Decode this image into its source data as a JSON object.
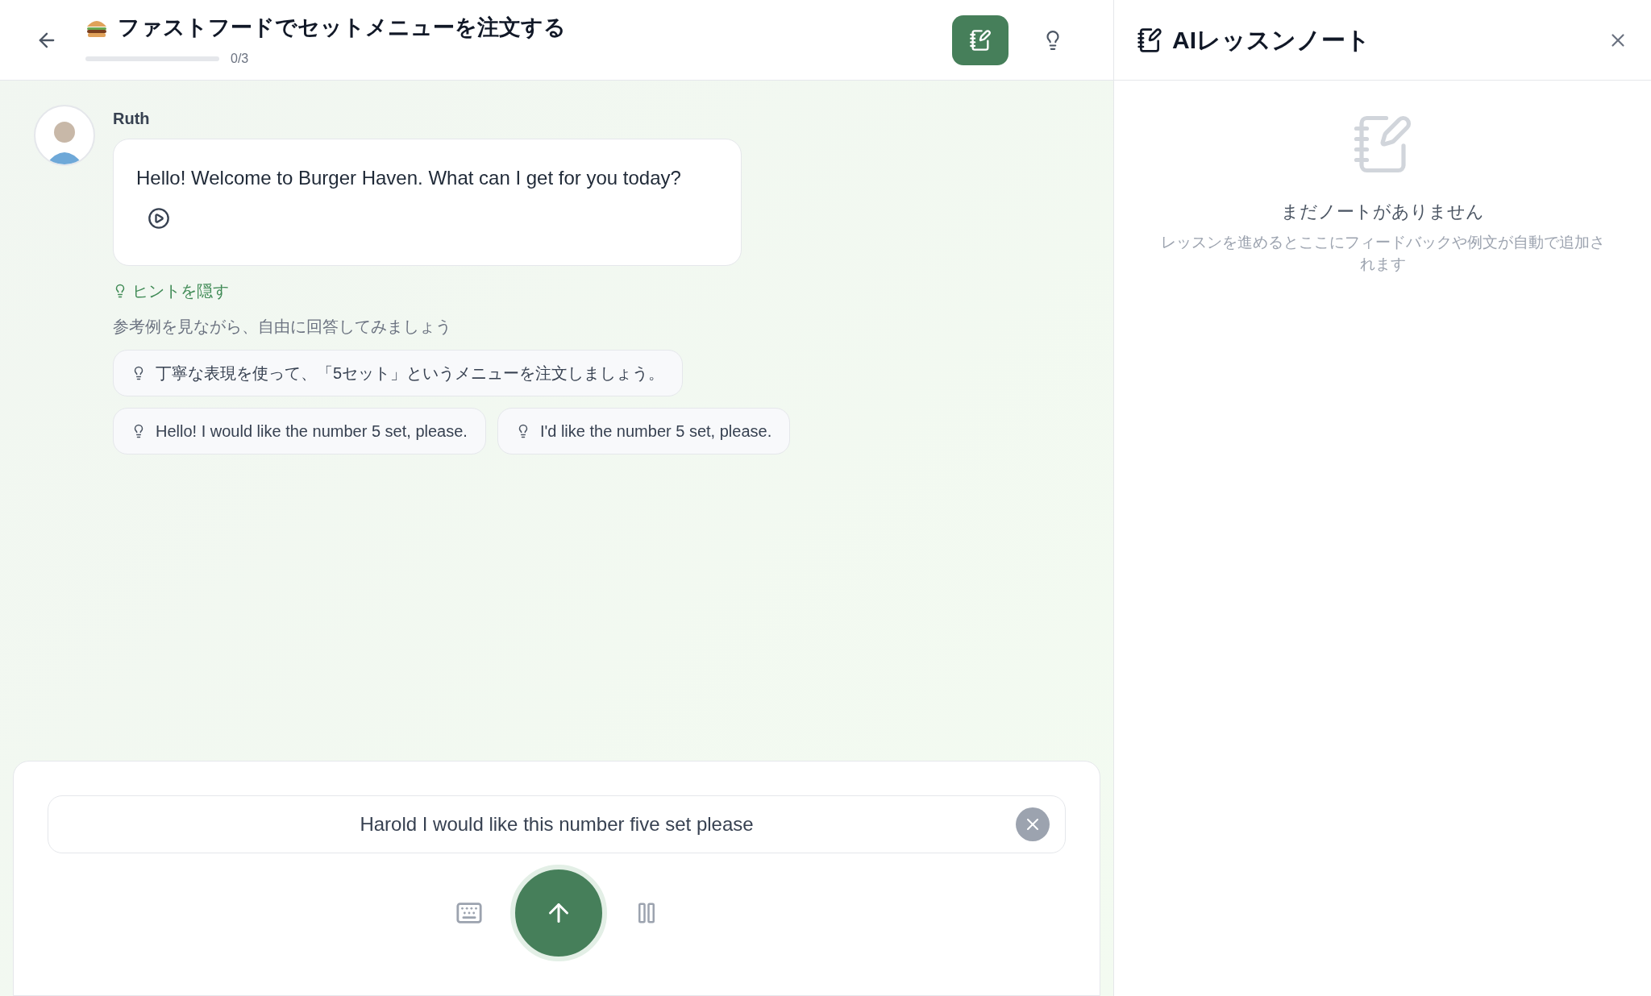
{
  "header": {
    "title": "ファストフードでセットメニューを注文する",
    "progress": {
      "level": 0,
      "reading": "0/3"
    },
    "notes_button": {
      "selected": true
    }
  },
  "message": {
    "speaker": "Ruth",
    "text": "Hello! Welcome to Burger Haven. What can I get for you today?"
  },
  "hints": {
    "toggle": "ヒントを隠す",
    "expanded": true,
    "instruction": "参考例を見ながら、自由に回答してみましょう",
    "items": [
      {
        "text": "丁寧な表現を使って、「5セット」というメニューを注文しましょう。"
      },
      {
        "text": "Hello! I would like the number 5 set, please."
      },
      {
        "text": "I'd like the number 5 set, please."
      }
    ]
  },
  "input": {
    "value": "Harold I would like this number five set please"
  },
  "notes_panel": {
    "title": "AIレッスンノート",
    "empty_title": "まだノートがありません",
    "empty_text": "レッスンを進めるとここにフィードバックや例文が自動で追加されます"
  }
}
